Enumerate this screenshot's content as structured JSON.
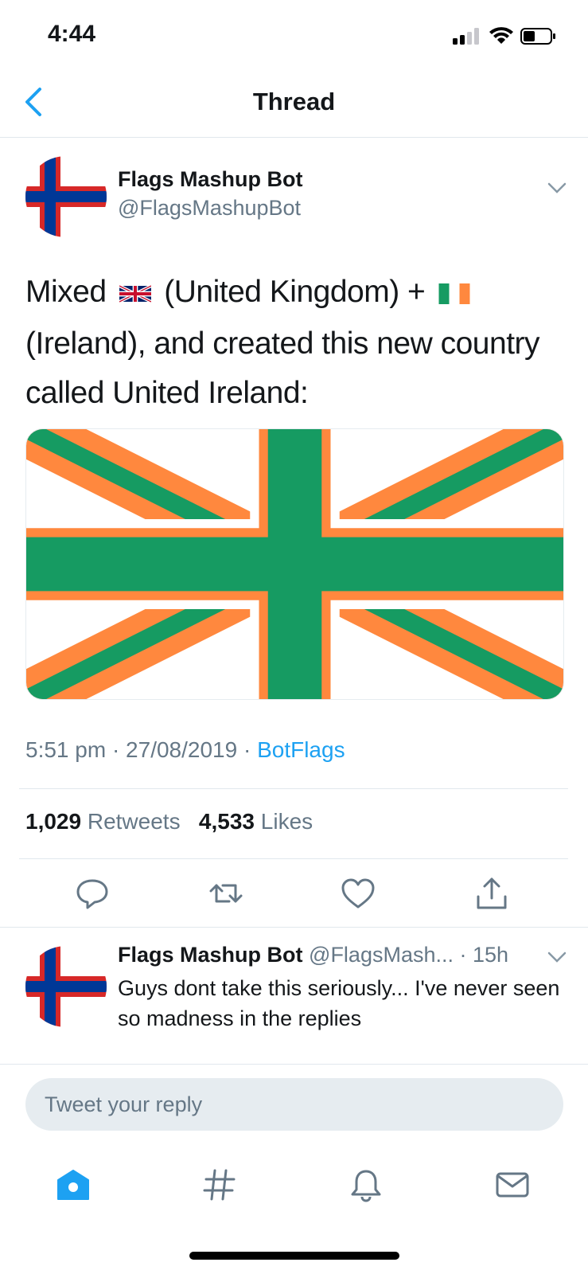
{
  "status_bar": {
    "time": "4:44"
  },
  "nav": {
    "title": "Thread"
  },
  "tweet": {
    "author_name": "Flags Mashup Bot",
    "author_handle": "@FlagsMashupBot",
    "text_part1": "Mixed",
    "text_part2": "(United Kingdom) +",
    "text_part3": "(Ireland), and created this new country called United Ireland:",
    "timestamp": "5:51 pm · 27/08/2019 · ",
    "source": "BotFlags",
    "retweets_count": "1,029",
    "retweets_label": "Retweets",
    "likes_count": "4,533",
    "likes_label": "Likes"
  },
  "reply": {
    "author_name": "Flags Mashup Bot",
    "author_handle_time": "@FlagsMash... · 15h",
    "text": "Guys dont take this seriously... I've never seen so madness in the replies"
  },
  "composer": {
    "placeholder": "Tweet your reply"
  },
  "icons": {
    "back": "chevron-left-icon",
    "more": "chevron-down-icon",
    "actions": [
      "reply-icon",
      "retweet-icon",
      "like-icon",
      "share-icon"
    ],
    "tabs": [
      "home-icon",
      "explore-hashtag-icon",
      "notifications-bell-icon",
      "messages-envelope-icon"
    ]
  },
  "colors": {
    "accent": "#1da1f2",
    "muted": "#657786",
    "flag_orange": "#ff883e",
    "flag_green": "#169b62",
    "faroe_red": "#d72828",
    "faroe_blue": "#003897"
  }
}
